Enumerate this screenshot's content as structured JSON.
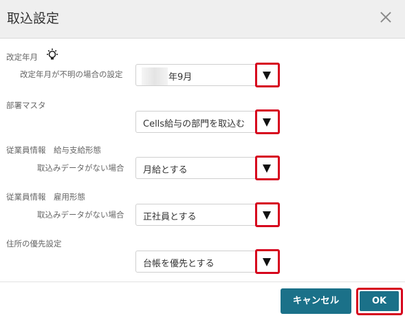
{
  "dialog": {
    "title": "取込設定"
  },
  "sections": [
    {
      "label": "改定年月",
      "sublabel": "改定年月が不明の場合の設定",
      "value": "年9月"
    },
    {
      "label": "部署マスタ",
      "sublabel": "",
      "value": "Cells給与の部門を取込む"
    },
    {
      "label": "従業員情報　給与支給形態",
      "sublabel": "取込みデータがない場合",
      "value": "月給とする"
    },
    {
      "label": "従業員情報　雇用形態",
      "sublabel": "取込みデータがない場合",
      "value": "正社員とする"
    },
    {
      "label": "住所の優先設定",
      "sublabel": "",
      "value": "台帳を優先とする"
    }
  ],
  "footer": {
    "cancel_label": "キャンセル",
    "ok_label": "OK"
  },
  "colors": {
    "button": "#1b7189",
    "highlight": "#d6001c"
  }
}
